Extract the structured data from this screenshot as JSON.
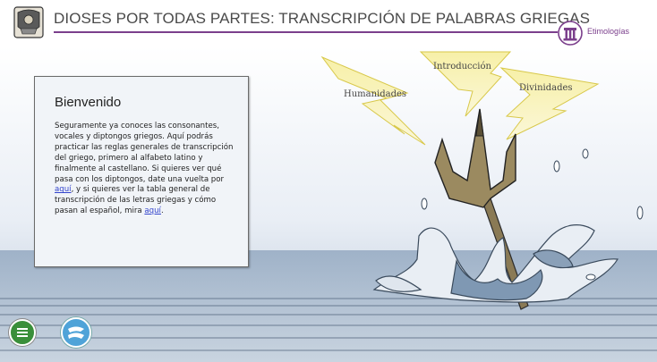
{
  "header": {
    "title": "DIOSES POR TODAS PARTES: TRANSCRIPCIÓN DE PALABRAS GRIEGAS",
    "brand_label": "Etimologías",
    "logo_icon": "university-crest-icon",
    "brand_icon": "column-icon"
  },
  "welcome": {
    "heading": "Bienvenido",
    "text_before_link1": "Seguramente ya conoces las consonantes, vocales y diptongos griegos. Aquí podrás practicar las reglas generales de transcripción del griego, primero al alfabeto latino y finalmente al castellano. Si quieres ver qué pasa con los diptongos, date una vuelta por ",
    "link1": "aquí",
    "text_between_links": ", y si quieres ver la tabla general de transcripción de las letras griegas y cómo pasan al español, mira ",
    "link2": "aquí",
    "text_after_link2": "."
  },
  "bolts": {
    "humanidades": "Humanidades",
    "introduccion": "Introducción",
    "divinidades": "Divinidades"
  },
  "controls": {
    "menu_icon": "menu-icon",
    "nav_icon": "wave-icon"
  },
  "colors": {
    "accent": "#7b3f8c",
    "bolt": "#f3ea8c",
    "sea": "#8fa6bf",
    "menu_green": "#3a8f3a",
    "nav_blue": "#4fa3d8"
  }
}
